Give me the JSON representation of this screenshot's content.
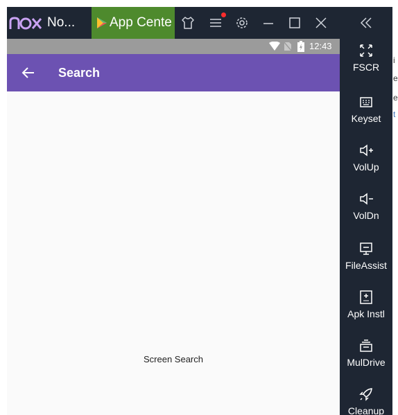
{
  "window": {
    "app_name": "No...",
    "tab_label": "App Cente",
    "icons": [
      "nox-logo-icon",
      "play-store-icon",
      "shirt-icon",
      "menu-icon",
      "settings-icon",
      "minimize-icon",
      "maximize-icon",
      "close-icon"
    ]
  },
  "status_bar": {
    "time": "12:43",
    "icons": [
      "wifi-icon",
      "no-sim-icon",
      "battery-icon"
    ]
  },
  "app_bar": {
    "title": "Search",
    "back_icon": "arrow-left-icon",
    "color": "#6c52b2"
  },
  "content": {
    "text": "Screen Search"
  },
  "toolbar": {
    "collapse_icon": "double-chevron-left-icon",
    "items": [
      {
        "label": "FSCR",
        "icon": "fullscreen-icon"
      },
      {
        "label": "Keyset",
        "icon": "keyboard-icon"
      },
      {
        "label": "VolUp",
        "icon": "volume-up-icon"
      },
      {
        "label": "VolDn",
        "icon": "volume-down-icon"
      },
      {
        "label": "FileAssist",
        "icon": "monitor-icon"
      },
      {
        "label": "Apk Instl",
        "icon": "apk-icon"
      },
      {
        "label": "MulDrive",
        "icon": "multi-drive-icon"
      },
      {
        "label": "Cleanup",
        "icon": "rocket-icon"
      }
    ]
  },
  "colors": {
    "chrome": "#1e2633",
    "tab_active": "#4e8a2d",
    "status_bar": "#9b9b9b",
    "content_bg": "#fafafa",
    "notification": "#ff2d2d"
  },
  "background_window": {
    "fragments": [
      "i",
      "e",
      "e",
      "t"
    ]
  }
}
